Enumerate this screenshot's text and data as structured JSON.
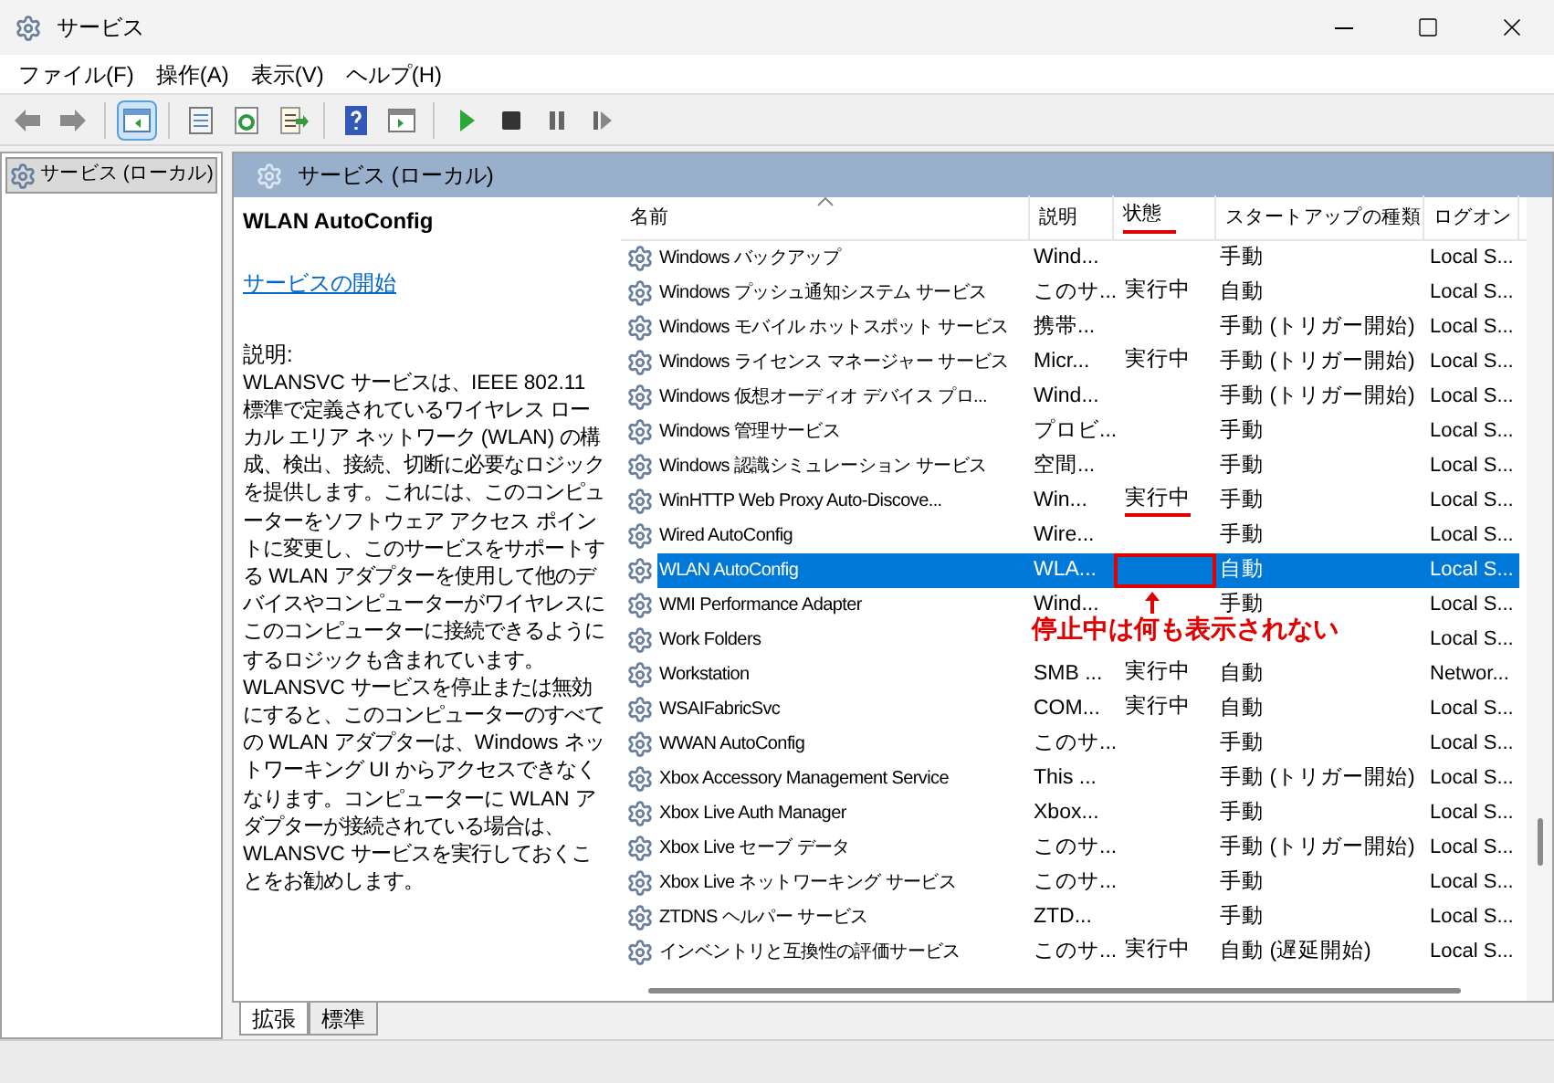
{
  "window": {
    "title": "サービス"
  },
  "menu": [
    "ファイル(F)",
    "操作(A)",
    "表示(V)",
    "ヘルプ(H)"
  ],
  "toolbar": [
    {
      "kind": "back",
      "disabled": false
    },
    {
      "kind": "forward",
      "disabled": false
    },
    {
      "kind": "tree",
      "selected": true
    },
    {
      "kind": "properties",
      "selected": false
    },
    {
      "kind": "refresh",
      "selected": false
    },
    {
      "kind": "export",
      "selected": false
    },
    {
      "kind": "help",
      "selected": false
    },
    {
      "kind": "view",
      "selected": false
    },
    {
      "kind": "play",
      "selected": false
    },
    {
      "kind": "stop",
      "selected": false
    },
    {
      "kind": "pause",
      "selected": false
    },
    {
      "kind": "resume",
      "selected": false
    }
  ],
  "tree": {
    "items": [
      {
        "label": "サービス (ローカル)",
        "selected": true
      }
    ]
  },
  "pane_header": "サービス (ローカル)",
  "details": {
    "title": "WLAN AutoConfig",
    "link": "サービスの開始",
    "description_label": "説明:",
    "description": "WLANSVC サービスは、IEEE 802.11 標準で定義されているワイヤレス ローカル エリア ネットワーク (WLAN) の構成、検出、接続、切断に必要なロジックを提供します。これには、このコンピューターをソフトウェア アクセス ポイントに変更し、このサービスをサポートする WLAN アダプターを使用して他のデバイスやコンピューターがワイヤレスにこのコンピューターに接続できるようにするロジックも含まれています。WLANSVC サービスを停止または無効にすると、このコンピューターのすべての WLAN アダプターは、Windows ネットワーキング UI からアクセスできなくなります。コンピューターに WLAN アダプターが接続されている場合は、WLANSVC サービスを実行しておくことをお勧めします。"
  },
  "table": {
    "columns": [
      {
        "label": "名前",
        "sorted": true,
        "underlined": false
      },
      {
        "label": "説明",
        "sorted": false,
        "underlined": false
      },
      {
        "label": "状態",
        "sorted": false,
        "underlined": true
      },
      {
        "label": "スタートアップの種類",
        "sorted": false,
        "underlined": false
      },
      {
        "label": "ログオン",
        "sorted": false,
        "underlined": false
      }
    ],
    "rows": [
      {
        "name": "Windows バックアップ",
        "description": "Wind...",
        "status": "",
        "startup": "手動",
        "logon": "Local S...",
        "selected": false,
        "underlined": false,
        "boxed": false
      },
      {
        "name": "Windows プッシュ通知システム サービス",
        "description": "このサ...",
        "status": "実行中",
        "startup": "自動",
        "logon": "Local S...",
        "selected": false,
        "underlined": false,
        "boxed": false
      },
      {
        "name": "Windows モバイル ホットスポット サービス",
        "description": "携帯...",
        "status": "",
        "startup": "手動 (トリガー開始)",
        "logon": "Local S...",
        "selected": false,
        "underlined": false,
        "boxed": false
      },
      {
        "name": "Windows ライセンス マネージャー サービス",
        "description": "Micr...",
        "status": "実行中",
        "startup": "手動 (トリガー開始)",
        "logon": "Local S...",
        "selected": false,
        "underlined": false,
        "boxed": false
      },
      {
        "name": "Windows 仮想オーディオ デバイス プロ...",
        "description": "Wind...",
        "status": "",
        "startup": "手動 (トリガー開始)",
        "logon": "Local S...",
        "selected": false,
        "underlined": false,
        "boxed": false
      },
      {
        "name": "Windows 管理サービス",
        "description": "プロビ...",
        "status": "",
        "startup": "手動",
        "logon": "Local S...",
        "selected": false,
        "underlined": false,
        "boxed": false
      },
      {
        "name": "Windows 認識シミュレーション サービス",
        "description": "空間...",
        "status": "",
        "startup": "手動",
        "logon": "Local S...",
        "selected": false,
        "underlined": false,
        "boxed": false
      },
      {
        "name": "WinHTTP Web Proxy Auto-Discove...",
        "description": "Win...",
        "status": "実行中",
        "startup": "手動",
        "logon": "Local S...",
        "selected": false,
        "underlined": true,
        "boxed": false
      },
      {
        "name": "Wired AutoConfig",
        "description": "Wire...",
        "status": "",
        "startup": "手動",
        "logon": "Local S...",
        "selected": false,
        "underlined": false,
        "boxed": false
      },
      {
        "name": "WLAN AutoConfig",
        "description": "WLA...",
        "status": "",
        "startup": "自動",
        "logon": "Local S...",
        "selected": true,
        "underlined": false,
        "boxed": true
      },
      {
        "name": "WMI Performance Adapter",
        "description": "Wind...",
        "status": "",
        "startup": "手動",
        "logon": "Local S...",
        "selected": false,
        "underlined": false,
        "boxed": false
      },
      {
        "name": "Work Folders",
        "description": "",
        "status": "",
        "startup": "",
        "logon": "Local S...",
        "selected": false,
        "underlined": false,
        "boxed": false
      },
      {
        "name": "Workstation",
        "description": "SMB ...",
        "status": "実行中",
        "startup": "自動",
        "logon": "Networ...",
        "selected": false,
        "underlined": false,
        "boxed": false
      },
      {
        "name": "WSAIFabricSvc",
        "description": "COM...",
        "status": "実行中",
        "startup": "自動",
        "logon": "Local S...",
        "selected": false,
        "underlined": false,
        "boxed": false
      },
      {
        "name": "WWAN AutoConfig",
        "description": "このサ...",
        "status": "",
        "startup": "手動",
        "logon": "Local S...",
        "selected": false,
        "underlined": false,
        "boxed": false
      },
      {
        "name": "Xbox Accessory Management Service",
        "description": "This ...",
        "status": "",
        "startup": "手動 (トリガー開始)",
        "logon": "Local S...",
        "selected": false,
        "underlined": false,
        "boxed": false
      },
      {
        "name": "Xbox Live Auth Manager",
        "description": "Xbox...",
        "status": "",
        "startup": "手動",
        "logon": "Local S...",
        "selected": false,
        "underlined": false,
        "boxed": false
      },
      {
        "name": "Xbox Live セーブ データ",
        "description": "このサ...",
        "status": "",
        "startup": "手動 (トリガー開始)",
        "logon": "Local S...",
        "selected": false,
        "underlined": false,
        "boxed": false
      },
      {
        "name": "Xbox Live ネットワーキング サービス",
        "description": "このサ...",
        "status": "",
        "startup": "手動",
        "logon": "Local S...",
        "selected": false,
        "underlined": false,
        "boxed": false
      },
      {
        "name": "ZTDNS ヘルパー サービス",
        "description": "ZTD...",
        "status": "",
        "startup": "手動",
        "logon": "Local S...",
        "selected": false,
        "underlined": false,
        "boxed": false
      },
      {
        "name": "インベントリと互換性の評価サービス",
        "description": "このサ...",
        "status": "実行中",
        "startup": "自動 (遅延開始)",
        "logon": "Local S...",
        "selected": false,
        "underlined": false,
        "boxed": false
      }
    ]
  },
  "annotation": {
    "text": "停止中は何も表示されない"
  },
  "view_tabs": [
    {
      "label": "拡張",
      "selected": true
    },
    {
      "label": "標準",
      "selected": false
    }
  ]
}
